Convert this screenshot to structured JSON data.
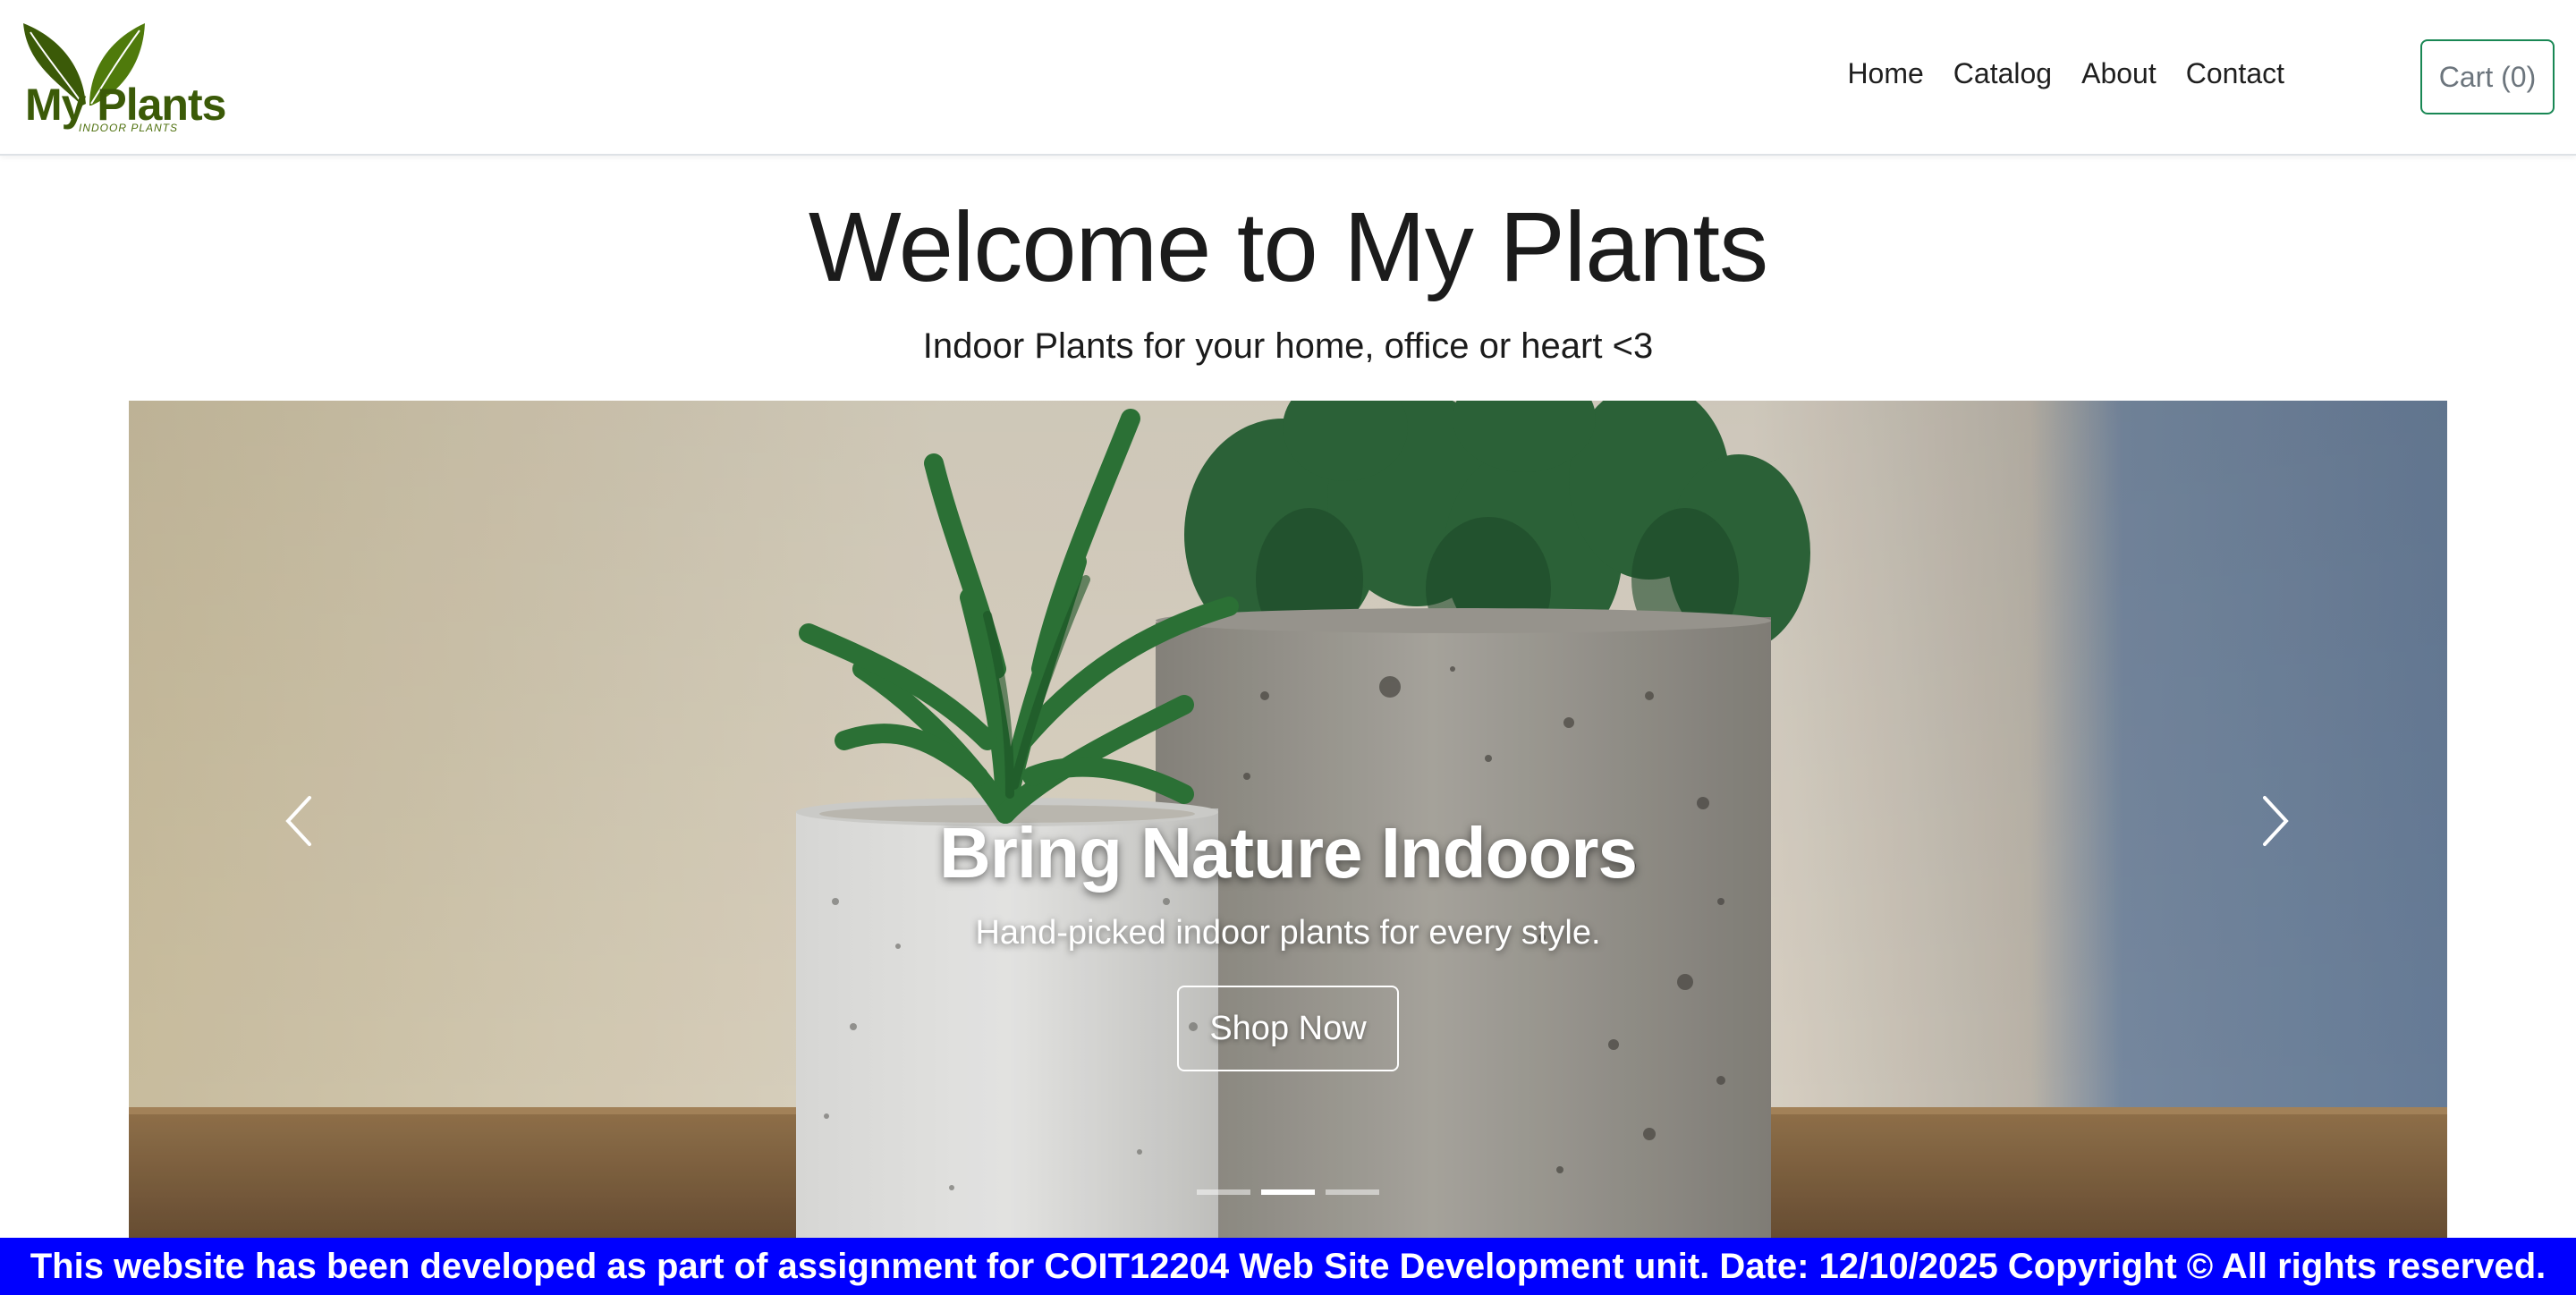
{
  "brand": {
    "name": "My Plants",
    "tagline": "INDOOR PLANTS",
    "color": "#3b5a08"
  },
  "nav": {
    "links": [
      {
        "label": "Home"
      },
      {
        "label": "Catalog"
      },
      {
        "label": "About"
      },
      {
        "label": "Contact"
      }
    ],
    "cart_label": "Cart (0)"
  },
  "hero": {
    "title": "Welcome to My Plants",
    "subtitle": "Indoor Plants for your home, office or heart <3"
  },
  "carousel": {
    "slides_count": 3,
    "active_slide": 2,
    "caption": {
      "title": "Bring Nature Indoors",
      "text": "Hand-picked indoor plants for every style.",
      "button_label": "Shop Now"
    },
    "prev_icon": "chevron-left-icon",
    "next_icon": "chevron-right-icon"
  },
  "footer": {
    "text": "This website has been developed as part of assignment for COIT12204 Web Site Development unit. Date: 12/10/2025 Copyright © All rights reserved.",
    "background": "#0000ff"
  }
}
